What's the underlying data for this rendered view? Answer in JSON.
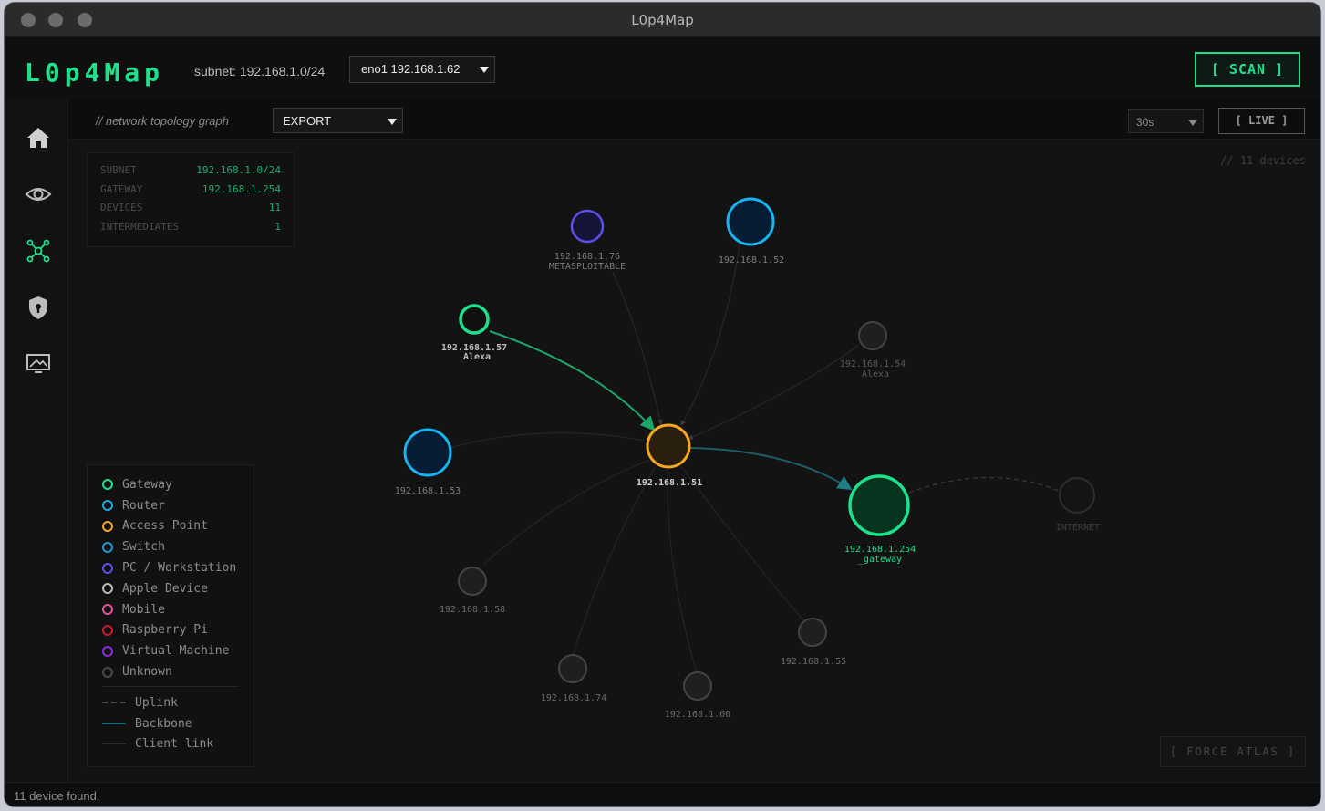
{
  "window": {
    "title": "L0p4Map"
  },
  "header": {
    "logo": "L0p4Map",
    "subnet_label": "subnet: 192.168.1.0/24",
    "interface": "eno1 192.168.1.62",
    "scan_label": "[ SCAN ]"
  },
  "sidebar": {
    "items": [
      {
        "icon": "home-icon"
      },
      {
        "icon": "eye-icon"
      },
      {
        "icon": "topology-icon",
        "active": true
      },
      {
        "icon": "shield-icon"
      },
      {
        "icon": "monitor-icon"
      }
    ]
  },
  "toolbar": {
    "comment": "// network topology graph",
    "export_label": "EXPORT",
    "interval": "30s",
    "live_label": "[ LIVE ]"
  },
  "info": {
    "rows": [
      {
        "key": "SUBNET",
        "value": "192.168.1.0/24"
      },
      {
        "key": "GATEWAY",
        "value": "192.168.1.254"
      },
      {
        "key": "DEVICES",
        "value": "11"
      },
      {
        "key": "INTERMEDIATES",
        "value": "1"
      }
    ]
  },
  "device_count": "// 11 devices",
  "legend": {
    "types": [
      {
        "label": "Gateway",
        "color": "#1de28b"
      },
      {
        "label": "Router",
        "color": "#1aa8e0"
      },
      {
        "label": "Access Point",
        "color": "#f5a623"
      },
      {
        "label": "Switch",
        "color": "#1d9bd8"
      },
      {
        "label": "PC / Workstation",
        "color": "#5b50e8"
      },
      {
        "label": "Apple Device",
        "color": "#b8b8b8"
      },
      {
        "label": "Mobile",
        "color": "#e0579c"
      },
      {
        "label": "Raspberry Pi",
        "color": "#c81c2e"
      },
      {
        "label": "Virtual Machine",
        "color": "#8a2be2"
      },
      {
        "label": "Unknown",
        "color": "#4a4a4a"
      }
    ],
    "links": [
      {
        "label": "Uplink",
        "style": "dashed"
      },
      {
        "label": "Backbone",
        "style": "solid-teal"
      },
      {
        "label": "Client link",
        "style": "thin"
      }
    ]
  },
  "graph": {
    "nodes": [
      {
        "id": "ap",
        "label": "192.168.1.51",
        "sublabel": "",
        "type": "access-point",
        "stroke": "#f5a623",
        "fill": "#2a1e0e",
        "bold": true
      },
      {
        "id": "n76",
        "label": "192.168.1.76",
        "sublabel": "METASPLOITABLE",
        "type": "pc",
        "stroke": "#5b50e8",
        "fill": "#17143a"
      },
      {
        "id": "n52",
        "label": "192.168.1.52",
        "sublabel": "",
        "type": "router",
        "stroke": "#18b4f0",
        "fill": "#061d33"
      },
      {
        "id": "n57",
        "label": "192.168.1.57",
        "sublabel": "Alexa",
        "type": "gateway-style",
        "stroke": "#1de28b",
        "fill": "#101010",
        "bold": true
      },
      {
        "id": "n54",
        "label": "192.168.1.54",
        "sublabel": "Alexa",
        "type": "unknown",
        "stroke": "#444",
        "fill": "#1f1f1f"
      },
      {
        "id": "n53",
        "label": "192.168.1.53",
        "sublabel": "",
        "type": "router",
        "stroke": "#18b4f0",
        "fill": "#061d33"
      },
      {
        "id": "gw",
        "label": "192.168.1.254",
        "sublabel": "_gateway",
        "type": "gateway",
        "stroke": "#1de28b",
        "fill": "#06341f",
        "highlight": true
      },
      {
        "id": "inet",
        "label": "INTERNET",
        "sublabel": "",
        "type": "internet",
        "stroke": "#2e2e2e",
        "fill": "#141414"
      },
      {
        "id": "n58",
        "label": "192.168.1.58",
        "sublabel": "",
        "type": "unknown",
        "stroke": "#444",
        "fill": "#1f1f1f"
      },
      {
        "id": "n74",
        "label": "192.168.1.74",
        "sublabel": "",
        "type": "unknown",
        "stroke": "#444",
        "fill": "#1f1f1f"
      },
      {
        "id": "n60",
        "label": "192.168.1.60",
        "sublabel": "",
        "type": "unknown",
        "stroke": "#444",
        "fill": "#1f1f1f"
      },
      {
        "id": "n55",
        "label": "192.168.1.55",
        "sublabel": "",
        "type": "unknown",
        "stroke": "#444",
        "fill": "#1f1f1f"
      }
    ]
  },
  "status": "11 device found.",
  "force_label": "[ FORCE ATLAS ]"
}
